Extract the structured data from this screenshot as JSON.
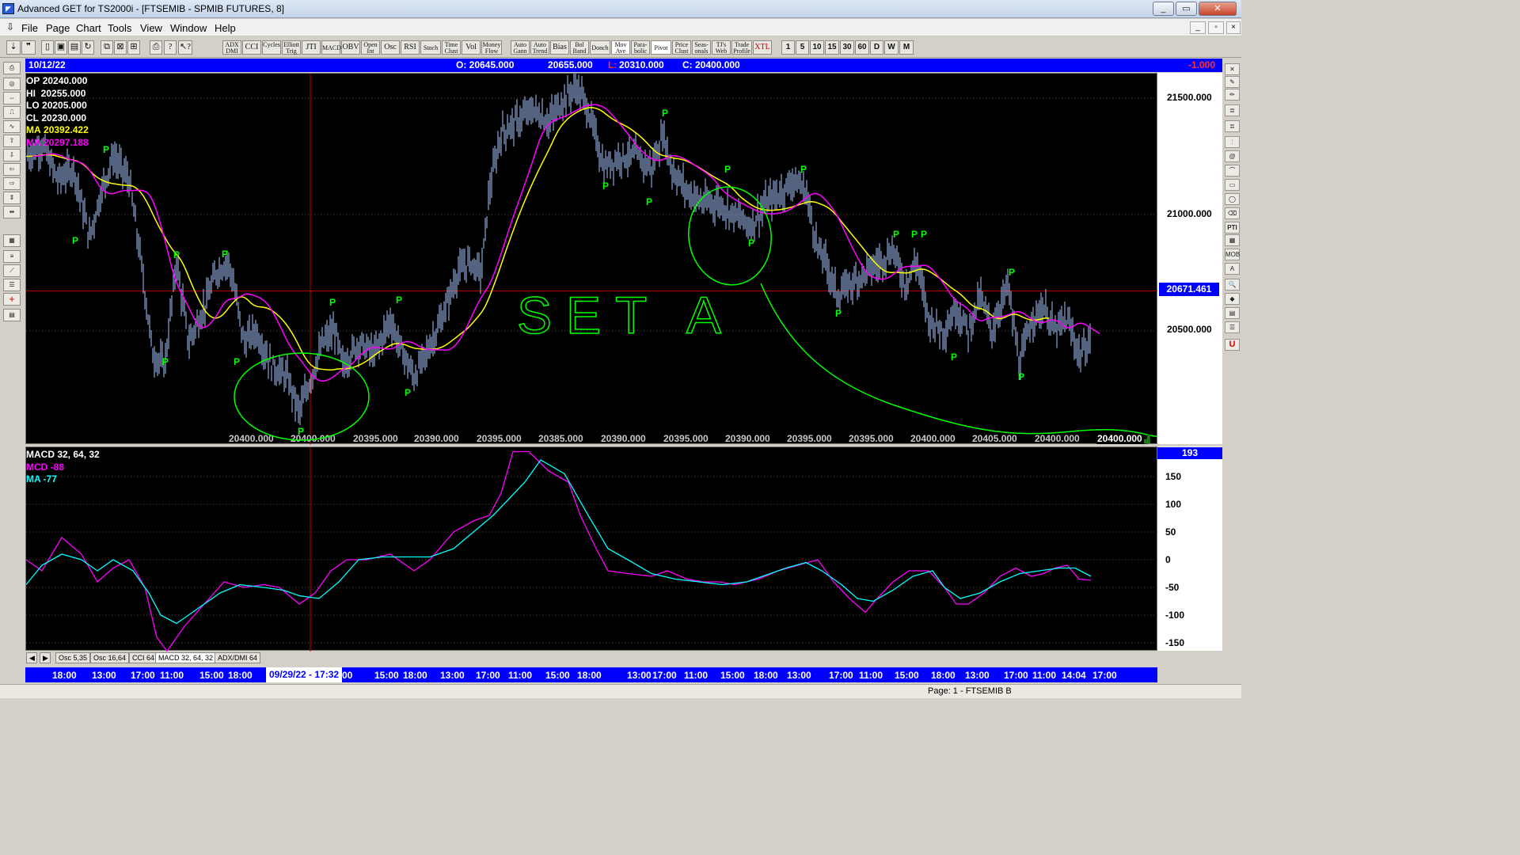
{
  "window": {
    "title": "Advanced GET for TS2000i - [FTSEMIB - SPMIB FUTURES, 8]",
    "app_icon": "get-logo"
  },
  "menu": [
    "File",
    "Page",
    "Chart",
    "Tools",
    "View",
    "Window",
    "Help"
  ],
  "toolbar": {
    "indicators": [
      "ADX DMI",
      "CCI",
      "Cycles",
      "Elliott Trig",
      "JTI",
      "MACD",
      "OBV",
      "Open Int",
      "Osc",
      "RSI",
      "Stoch",
      "Time Clust",
      "Vol",
      "Money Flow",
      "Auto Gann",
      "Auto Trend",
      "Bias",
      "Bol Band",
      "Donch",
      "Mov Ave",
      "Para-bolic",
      "Pivot",
      "Price Clust",
      "Seas-onals",
      "TJ's Web",
      "Trade Profile",
      "XTL"
    ],
    "timeframes": [
      "1",
      "5",
      "10",
      "15",
      "30",
      "60",
      "D",
      "W",
      "M"
    ]
  },
  "left_tools": [
    "PRINT",
    "SHAPES",
    "RESET",
    "STUDY",
    "Elliott",
    "UP",
    "DOWN",
    "LEFT",
    "RIGHT",
    "ZOOM",
    "SCALE",
    "GRID",
    "LINES",
    "GANN",
    "FIB",
    "CROSS",
    "SAVE"
  ],
  "right_tools": [
    "X",
    "PEN",
    "PENCIL",
    "FIB RET",
    "FIB EXT",
    "FIB TIME",
    "SPIRAL",
    "ARC",
    "BOX",
    "ELLIPS",
    "ERASE",
    "PTI",
    "GRID",
    "MOB",
    "A",
    "ZOOM",
    "ALERT",
    "CALC",
    "U"
  ],
  "price_header": {
    "date": "10/12/22",
    "open": "O: 20645.000",
    "high": "20655.000",
    "low_label": "L:",
    "low": "20310.000",
    "close": "C: 20400.000",
    "change": "-1.000"
  },
  "info_box": [
    {
      "label": "OP",
      "value": "20240.000",
      "color": "#ffffff"
    },
    {
      "label": "HI",
      "value": "20255.000",
      "color": "#ffffff"
    },
    {
      "label": "LO",
      "value": "20205.000",
      "color": "#ffffff"
    },
    {
      "label": "CL",
      "value": "20230.000",
      "color": "#ffffff"
    },
    {
      "label": "MA",
      "value": "20392.422",
      "color": "#ffff00"
    },
    {
      "label": "MA",
      "value": "20297.188",
      "color": "#ff00ff"
    }
  ],
  "price_axis": {
    "ticks": [
      "21500.000",
      "21000.000",
      "20500.000"
    ],
    "crosshair_value": "20671.461"
  },
  "bottom_values": [
    "20400.000",
    "20400.000",
    "20395.000",
    "20390.000",
    "20395.000",
    "20385.000",
    "20390.000",
    "20395.000",
    "20390.000",
    "20395.000",
    "20395.000",
    "20400.000",
    "20405.000",
    "20400.000",
    "20400.000"
  ],
  "annotation_text": "SET A",
  "pivot_marker": "P",
  "macd": {
    "title": "MACD 32, 64, 32",
    "mcd_label": "MCD -88",
    "ma_label": "MA   -77",
    "axis_top": "193",
    "ticks": [
      "150",
      "100",
      "50",
      "0",
      "-50",
      "-100",
      "-150"
    ],
    "colors": {
      "mcd": "#ff00ff",
      "ma": "#00ffff"
    }
  },
  "tabs": [
    "Osc 5,35",
    "Osc 16,64",
    "CCI 64",
    "MACD 32, 64, 32",
    "ADX/DMI 64"
  ],
  "time_axis": {
    "cursor_label": "09/29/22 - 17:32",
    "labels": [
      "18:00",
      "13:00",
      "17:00",
      "11:00",
      "15:00",
      "18:00",
      "00",
      "15:00",
      "18:00",
      "13:00",
      "17:00",
      "11:00",
      "15:00",
      "18:00",
      "13:00",
      "17:00",
      "11:00",
      "15:00",
      "18:00",
      "13:00",
      "17:00",
      "11:00",
      "15:00",
      "18:00",
      "13:00",
      "17:00",
      "11:00",
      "14:04",
      "17:00"
    ]
  },
  "status": "Page: 1 - FTSEMIB B",
  "colors": {
    "price_bars": "#a8c8ff",
    "ma_fast": "#ffff00",
    "ma_slow": "#ff00ff",
    "pivot": "#00ff00",
    "annotation": "#00ff00",
    "crosshair": "#c00000"
  }
}
